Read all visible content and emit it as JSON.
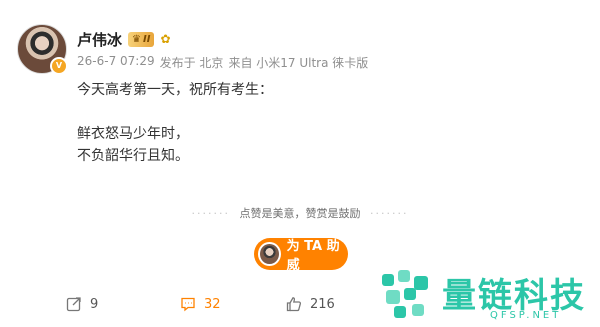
{
  "user": {
    "name": "卢伟冰",
    "badge_text": "II",
    "verified_mark": "V"
  },
  "meta": {
    "date": "26-6-7 07:29",
    "location": "发布于 北京",
    "source": "来自 小米17 Ultra 徕卡版"
  },
  "post": {
    "line1": "今天高考第一天，祝所有考生：",
    "line2": "鲜衣怒马少年时，",
    "line3": "不负韶华行且知。"
  },
  "hint": {
    "text": "点赞是美意，赞赏是鼓励"
  },
  "boost": {
    "label": "为 TA 助威"
  },
  "actions": {
    "share_count": "9",
    "comment_count": "32",
    "like_count": "216"
  },
  "watermark": {
    "title": "量链科技",
    "sub": "QFSP.NET"
  },
  "colors": {
    "accent": "#ff8200",
    "watermark": "#2cc6a8"
  }
}
